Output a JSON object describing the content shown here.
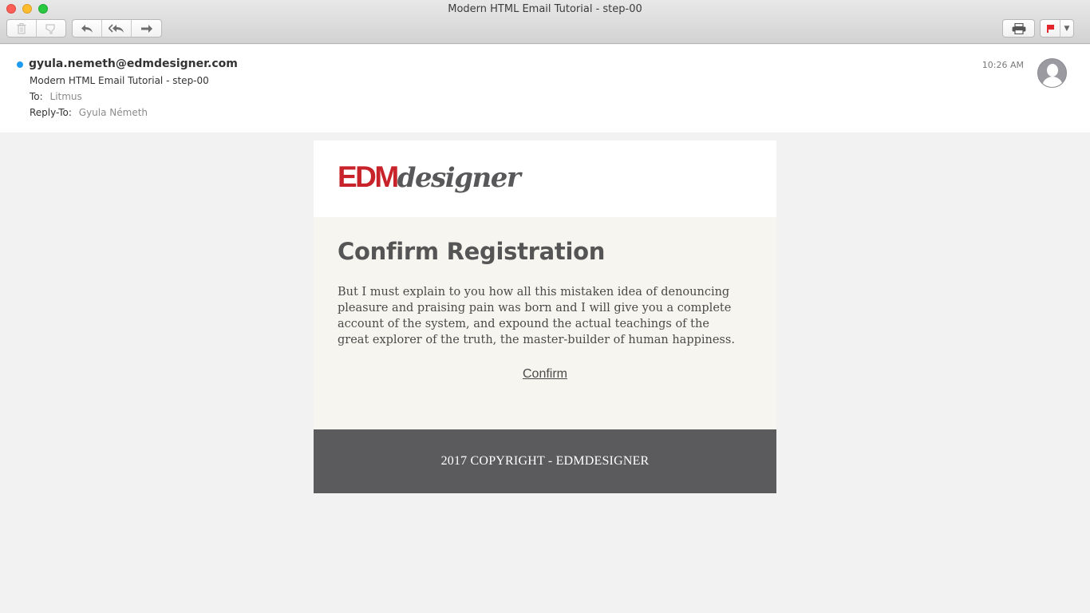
{
  "window": {
    "title": "Modern HTML Email Tutorial - step-00"
  },
  "toolbar": {
    "delete_icon": "trash-icon",
    "junk_icon": "junk-icon",
    "reply_icon": "reply-icon",
    "reply_all_icon": "reply-all-icon",
    "forward_icon": "forward-icon",
    "print_icon": "printer-icon",
    "flag_icon": "flag-icon",
    "flag_color": "#e3262b"
  },
  "message": {
    "from": "gyula.nemeth@edmdesigner.com",
    "subject": "Modern HTML Email Tutorial - step-00",
    "to_label": "To:",
    "to_value": "Litmus",
    "reply_to_label": "Reply-To:",
    "reply_to_value": "Gyula Németh",
    "time": "10:26 AM",
    "unread_color": "#1e9bf0"
  },
  "email": {
    "logo_part1": "EDM",
    "logo_part2": "designer",
    "brand_color": "#c8222a",
    "headline": "Confirm Registration",
    "body": "But I must explain to you how all this mistaken idea of denouncing pleasure and praising pain was born and I will give you a complete account of the system, and expound the actual teachings of the great explorer of the truth, the master-builder of human happiness.",
    "confirm_link": "Confirm",
    "footer": "2017 COPYRIGHT - EDMDESIGNER"
  }
}
